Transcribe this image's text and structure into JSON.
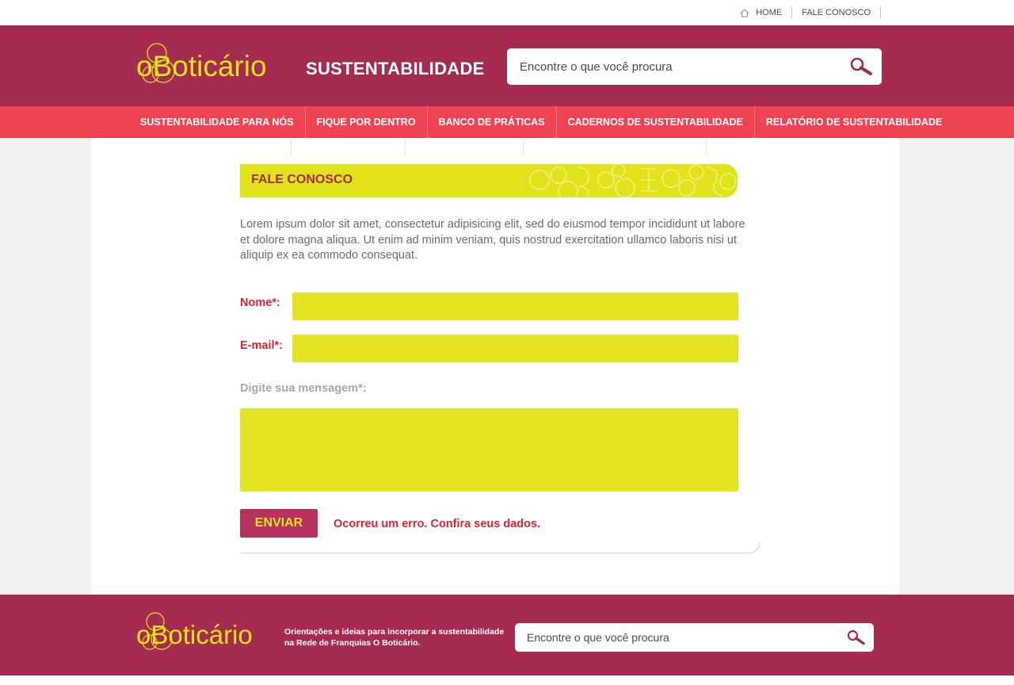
{
  "topbar": {
    "home_label": "HOME",
    "contact_label": "FALE CONOSCO",
    "home_icon": "house-icon"
  },
  "header": {
    "logo_text": "oBoticário",
    "section_title": "SUSTENTABILIDADE",
    "search_placeholder": "Encontre o que você procura",
    "search_icon": "magnifier-icon"
  },
  "nav": {
    "items": [
      {
        "label": "SUSTENTABILIDADE PARA NÓS"
      },
      {
        "label": "FIQUE POR DENTRO"
      },
      {
        "label": "BANCO DE PRÁTICAS"
      },
      {
        "label": "CADERNOS DE SUSTENTABILIDADE"
      },
      {
        "label": "RELATÓRIO DE SUSTENTABILIDADE"
      }
    ]
  },
  "page": {
    "title": "FALE CONOSCO",
    "intro": "Lorem ipsum dolor sit amet, consectetur adipisicing elit, sed do eiusmod tempor incididunt ut labore et dolore magna aliqua. Ut enim ad minim veniam, quis nostrud exercitation ullamco laboris nisi ut aliquip ex ea commodo consequat."
  },
  "form": {
    "name_label": "Nome*:",
    "name_value": "",
    "email_label": "E-mail*:",
    "email_value": "",
    "message_label": "Digite sua mensagem*:",
    "message_value": "",
    "submit_label": "ENVIAR",
    "error_message": "Ocorreu um erro. Confira seus dados."
  },
  "footer": {
    "logo_text": "oBoticário",
    "tagline": "Orientações e ideias para incorporar a sustentabilidade na Rede de Franquias O Boticário.",
    "search_placeholder": "Encontre o que você procura"
  },
  "colors": {
    "brand_wine": "#a52b50",
    "nav_red": "#ef4352",
    "accent_yellow": "#e0e21a",
    "field_yellow": "#e3e424",
    "error_red": "#e4202d",
    "button_bg": "#b7325f"
  }
}
